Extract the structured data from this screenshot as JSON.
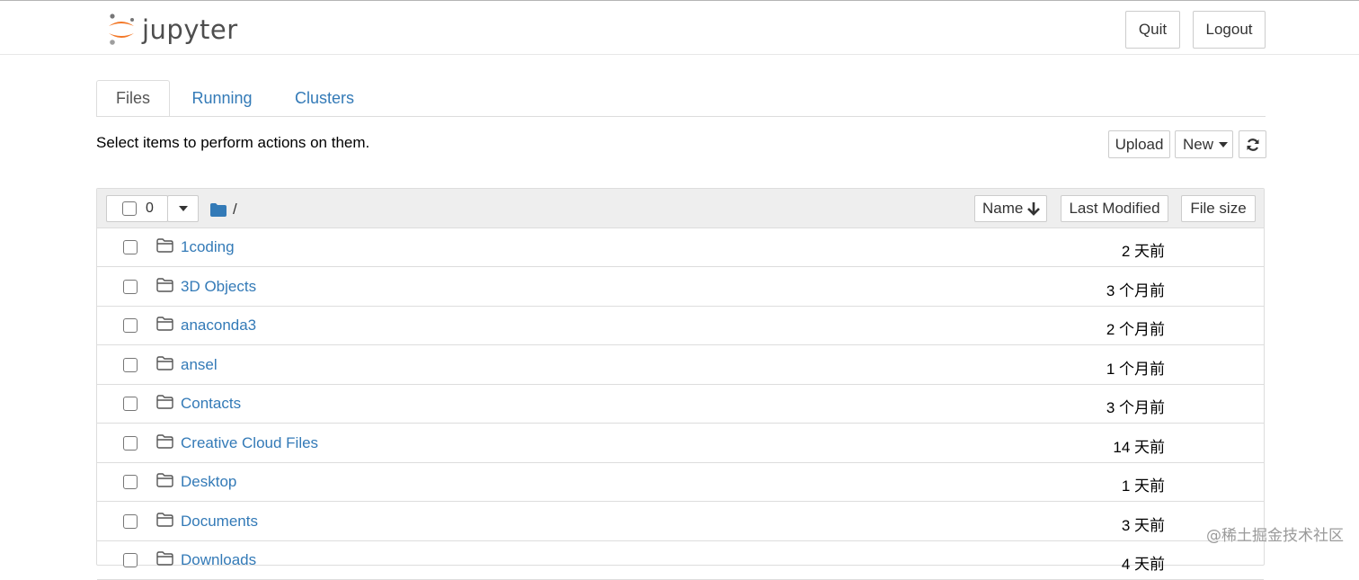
{
  "app": {
    "logo_text": "jupyter"
  },
  "header": {
    "quit_label": "Quit",
    "logout_label": "Logout"
  },
  "tabs": [
    {
      "label": "Files",
      "active": true
    },
    {
      "label": "Running",
      "active": false
    },
    {
      "label": "Clusters",
      "active": false
    }
  ],
  "toolbar": {
    "hint": "Select items to perform actions on them.",
    "upload_label": "Upload",
    "new_label": "New",
    "refresh_icon": "refresh-icon"
  },
  "list_header": {
    "selected_count": "0",
    "path": "/",
    "sort_name_label": "Name",
    "sort_modified_label": "Last Modified",
    "sort_size_label": "File size"
  },
  "files": [
    {
      "name": "1coding",
      "modified": "2 天前"
    },
    {
      "name": "3D Objects",
      "modified": "3 个月前"
    },
    {
      "name": "anaconda3",
      "modified": "2 个月前"
    },
    {
      "name": "ansel",
      "modified": "1 个月前"
    },
    {
      "name": "Contacts",
      "modified": "3 个月前"
    },
    {
      "name": "Creative Cloud Files",
      "modified": "14 天前"
    },
    {
      "name": "Desktop",
      "modified": "1 天前"
    },
    {
      "name": "Documents",
      "modified": "3 天前"
    },
    {
      "name": "Downloads",
      "modified": "4 天前"
    }
  ],
  "watermark": "@稀土掘金技术社区",
  "colors": {
    "link": "#337ab7",
    "logo_orange": "#f37726",
    "header_bg": "#eeeeee"
  }
}
